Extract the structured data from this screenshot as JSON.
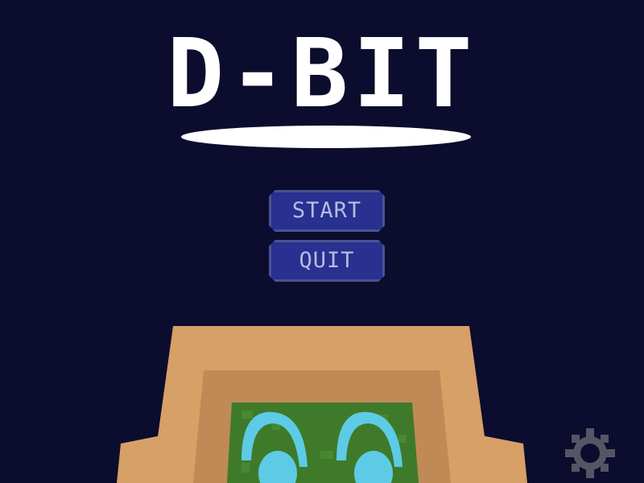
{
  "game": {
    "title": "D-BIT"
  },
  "menu": {
    "start_label": "START",
    "quit_label": "QUIT"
  },
  "icons": {
    "settings": "gear-icon"
  },
  "colors": {
    "background": "#0c0c2e",
    "title": "#ffffff",
    "button_fill": "#283090",
    "button_border": "#4a5394",
    "button_text": "#b7bbe0",
    "robot_outer": "#d6a066",
    "robot_inner": "#bf8a55",
    "robot_screen": "#3e7a2a",
    "robot_eye": "#5dcbe5",
    "gear": "#555566"
  }
}
